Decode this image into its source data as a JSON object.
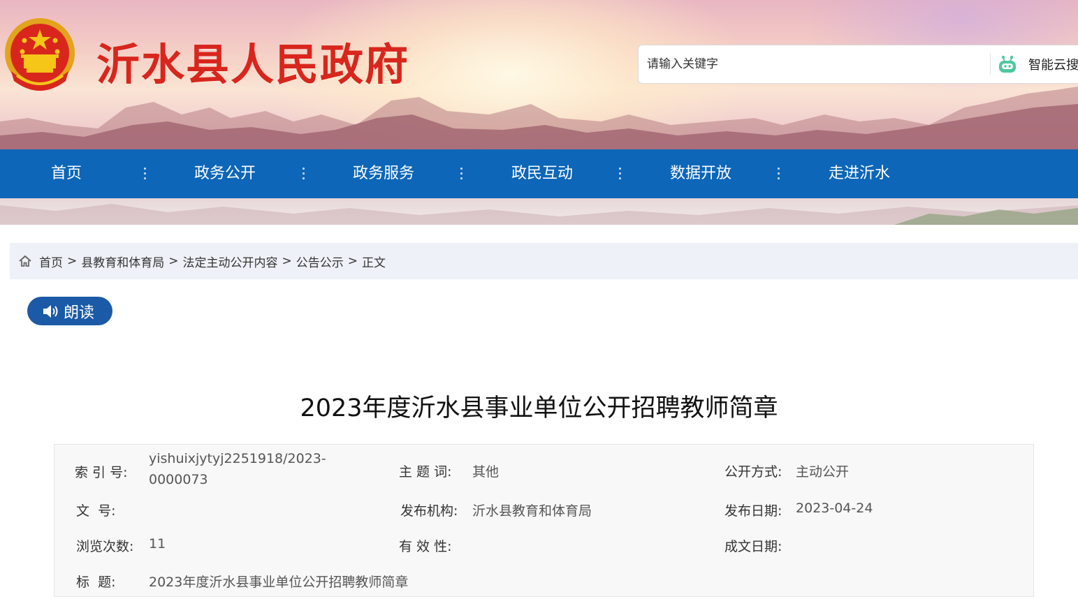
{
  "header": {
    "site_title": "沂水县人民政府",
    "search": {
      "placeholder": "请输入关键字",
      "ai_label": "智能云搜"
    }
  },
  "nav": {
    "items": [
      {
        "label": "首页"
      },
      {
        "label": "政务公开"
      },
      {
        "label": "政务服务"
      },
      {
        "label": "政民互动"
      },
      {
        "label": "数据开放"
      },
      {
        "label": "走进沂水"
      }
    ]
  },
  "breadcrumb": {
    "items": [
      "首页",
      "县教育和体育局",
      "法定主动公开内容",
      "公告公示"
    ],
    "separator": ">",
    "current": "正文"
  },
  "read_button": {
    "label": "朗读"
  },
  "article": {
    "title": "2023年度沂水县事业单位公开招聘教师简章",
    "meta": {
      "index_label": "索 引 号:",
      "index_value_line1": "yishuixjytyj2251918/2023-",
      "index_value_line2": "0000073",
      "subject_label": "主 题 词:",
      "subject_value": "其他",
      "method_label": "公开方式:",
      "method_value": "主动公开",
      "docno_label": "文  号:",
      "docno_value": "",
      "org_label": "发布机构:",
      "org_value": "沂水县教育和体育局",
      "date_label": "发布日期:",
      "date_value": "2023-04-24",
      "views_label": "浏览次数:",
      "views_value": "11",
      "validity_label": "有 效 性:",
      "validity_value": "",
      "written_label": "成文日期:",
      "written_value": "",
      "title_label": "标  题:",
      "title_value": "2023年度沂水县事业单位公开招聘教师简章"
    }
  },
  "colors": {
    "nav_bg": "#0d66b8",
    "title_red": "#d8261d",
    "read_button_bg": "#1a5aa6",
    "breadcrumb_bg": "#eef1f7"
  }
}
